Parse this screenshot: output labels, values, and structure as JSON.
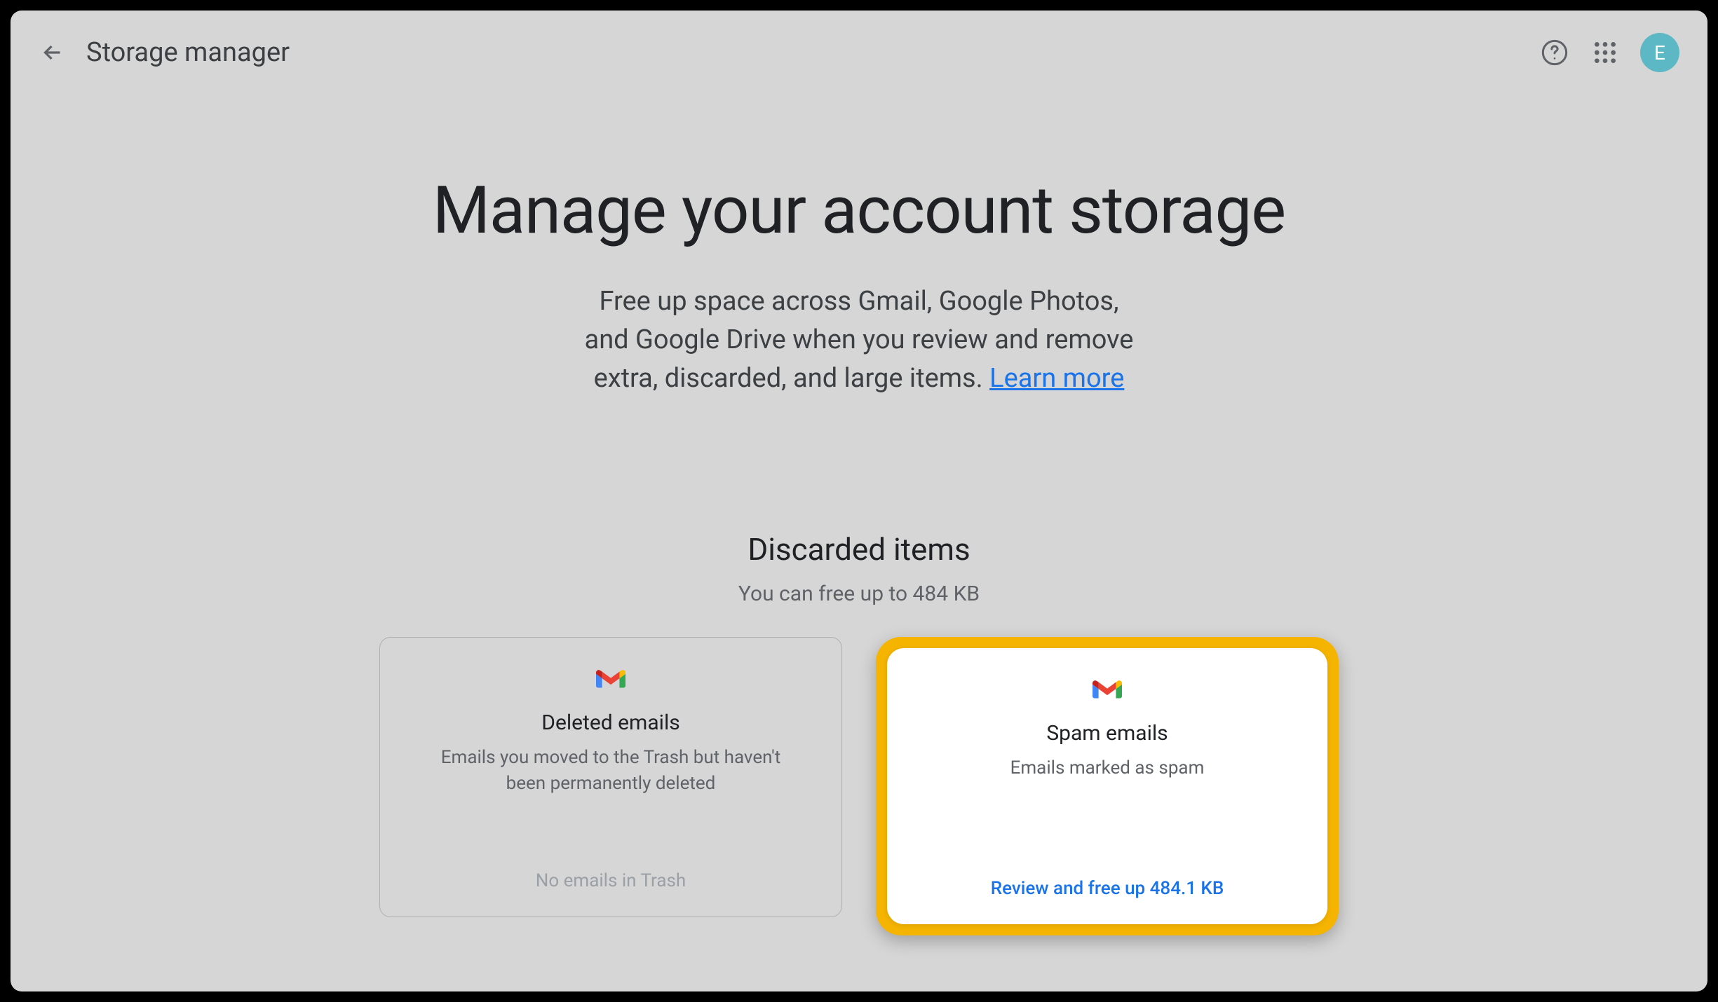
{
  "header": {
    "title": "Storage manager",
    "avatar_initial": "E"
  },
  "main": {
    "heading": "Manage your account storage",
    "description_line1": "Free up space across Gmail, Google Photos,",
    "description_line2": "and Google Drive when you review and remove",
    "description_line3": "extra, discarded, and large items. ",
    "learn_more": "Learn more"
  },
  "section": {
    "title": "Discarded items",
    "subtitle": "You can free up to  484 KB"
  },
  "cards": {
    "deleted": {
      "title": "Deleted emails",
      "description": "Emails you moved to the Trash but haven't been permanently deleted",
      "footer": "No emails in Trash"
    },
    "spam": {
      "title": "Spam emails",
      "description": "Emails marked as spam",
      "action": "Review and free up 484.1 KB"
    }
  }
}
